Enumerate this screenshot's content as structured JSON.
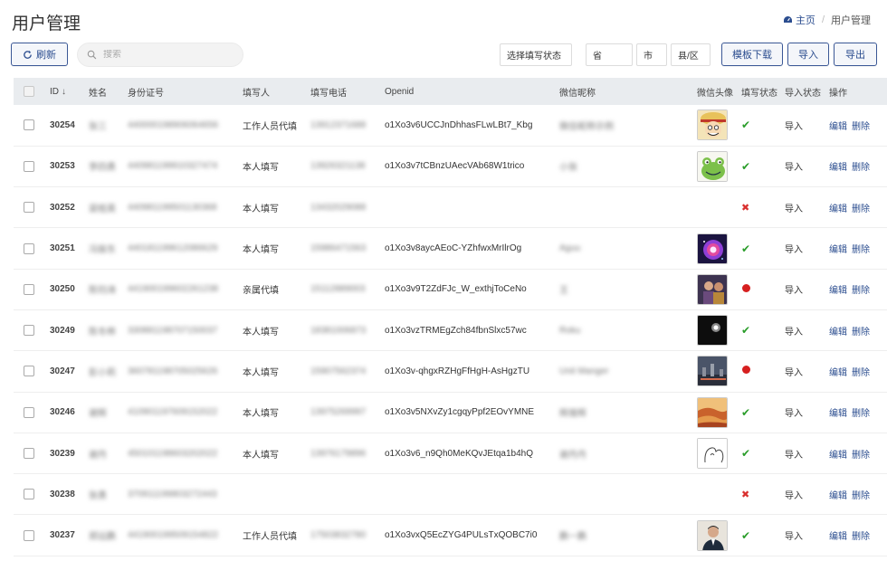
{
  "page": {
    "title": "用户管理"
  },
  "breadcrumb": {
    "home": "主页",
    "current": "用户管理"
  },
  "toolbar": {
    "refresh_label": "刷新",
    "search_placeholder": "搜索",
    "status_select": "选择填写状态",
    "province_select": "省",
    "city_select": "市",
    "county_select": "县/区",
    "template_label": "模板下载",
    "import_label": "导入",
    "export_label": "导出"
  },
  "table": {
    "columns": [
      "ID",
      "姓名",
      "身份证号",
      "填写人",
      "填写电话",
      "Openid",
      "微信昵称",
      "微信头像",
      "填写状态",
      "导入状态",
      "操作"
    ],
    "action_edit": "编辑",
    "action_delete": "删除",
    "rows": [
      {
        "id": "30254",
        "name": "张三",
        "idno": "440000198906064656",
        "filler": "工作人员代填",
        "phone": "13912371688",
        "openid": "o1Xo3v6UCCJnDhhasFLwLBt7_Kbg",
        "nickname": "微信昵称示例",
        "avatar": "luffy",
        "fill_status": "ok",
        "import_status": "导入"
      },
      {
        "id": "30253",
        "name": "李四勇",
        "idno": "440981199910327474",
        "filler": "本人填写",
        "phone": "13926321138",
        "openid": "o1Xo3v7tCBnzUAecVAb68W1trico",
        "nickname": "小张",
        "avatar": "frog",
        "fill_status": "ok",
        "import_status": "导入"
      },
      {
        "id": "30252",
        "name": "梁桂英",
        "idno": "440981199501130368",
        "filler": "本人填写",
        "phone": "13432029088",
        "openid": "",
        "nickname": "",
        "avatar": "",
        "fill_status": "err",
        "import_status": "导入"
      },
      {
        "id": "30251",
        "name": "冯振东",
        "idno": "440181199612086629",
        "filler": "本人填写",
        "phone": "15986471563",
        "openid": "o1Xo3v8aycAEoC-YZhfwxMrIlrOg",
        "nickname": "Aguu",
        "avatar": "galaxy",
        "fill_status": "ok",
        "import_status": "导入"
      },
      {
        "id": "30250",
        "name": "陈钧涛",
        "idno": "441900199602261238",
        "filler": "亲属代填",
        "phone": "15112889003",
        "openid": "o1Xo3v9T2ZdFJc_W_exthjToCeNo",
        "nickname": "王",
        "avatar": "people",
        "fill_status": "dot",
        "import_status": "导入"
      },
      {
        "id": "30249",
        "name": "陈冬桦",
        "idno": "330881198707150037",
        "filler": "本人填写",
        "phone": "18381006873",
        "openid": "o1Xo3vzTRMEgZch84fbnSlxc57wc",
        "nickname": "Roku",
        "avatar": "dark",
        "fill_status": "ok",
        "import_status": "导入"
      },
      {
        "id": "30247",
        "name": "彭小莉",
        "idno": "360781198705025626",
        "filler": "本人填写",
        "phone": "15907562374",
        "openid": "o1Xo3v-qhgxRZHgFfHgH-AsHgzTU",
        "nickname": "Unit Manger",
        "avatar": "city",
        "fill_status": "dot",
        "import_status": "导入"
      },
      {
        "id": "30246",
        "name": "谢辉",
        "idno": "410901197609152022",
        "filler": "本人填写",
        "phone": "13975269997",
        "openid": "o1Xo3v5NXvZy1cgqyPpf2EOvYMNE",
        "nickname": "辉煌辉",
        "avatar": "desert",
        "fill_status": "ok",
        "import_status": "导入"
      },
      {
        "id": "30239",
        "name": "谢丹",
        "idno": "450101198603202022",
        "filler": "本人填写",
        "phone": "13976179896",
        "openid": "o1Xo3v6_n9Qh0MeKQvJEtqa1b4hQ",
        "nickname": "谢丹丹",
        "avatar": "sketch",
        "fill_status": "ok",
        "import_status": "导入"
      },
      {
        "id": "30238",
        "name": "张勇",
        "idno": "370911199803272443",
        "filler": "",
        "phone": "",
        "openid": "",
        "nickname": "",
        "avatar": "",
        "fill_status": "err",
        "import_status": "导入"
      },
      {
        "id": "30237",
        "name": "郑远鹏",
        "idno": "441900199509154822",
        "filler": "工作人员代填",
        "phone": "17503832780",
        "openid": "o1Xo3vxQ5EcZYG4PULsTxQOBC7i0",
        "nickname": "鹏一鹏",
        "avatar": "man",
        "fill_status": "ok",
        "import_status": "导入"
      }
    ]
  },
  "colors": {
    "accent": "#2b4d8f",
    "ok": "#2a9d2a",
    "err": "#d9302f",
    "header_bg": "#e9ecef"
  }
}
